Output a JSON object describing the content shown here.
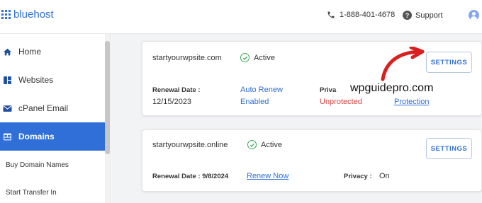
{
  "header": {
    "logo_text": "bluehost",
    "phone": "1-888-401-4678",
    "support_label": "Support"
  },
  "sidebar": {
    "items": [
      {
        "label": "Home",
        "icon": "home-icon"
      },
      {
        "label": "Websites",
        "icon": "websites-icon"
      },
      {
        "label": "cPanel Email",
        "icon": "mail-icon"
      },
      {
        "label": "Domains",
        "icon": "domains-icon",
        "active": true
      }
    ],
    "subitems": [
      "Buy Domain Names",
      "Start Transfer In"
    ]
  },
  "domains": [
    {
      "name": "startyourwpsite.com",
      "status": "Active",
      "renewal_label": "Renewal Date :",
      "renewal_date": "12/15/2023",
      "auto_renew_line1": "Auto Renew",
      "auto_renew_line2": "Enabled",
      "privacy_label": "Priva",
      "privacy_value": "Unprotected",
      "privacy_link": "Protection",
      "settings_label": "SETTINGS"
    },
    {
      "name": "startyourwpsite.online",
      "status": "Active",
      "renewal_label": "Renewal Date : 9/8/2024",
      "renew_link": "Renew Now",
      "privacy_label": "Privacy :",
      "privacy_value": "On",
      "settings_label": "SETTINGS"
    }
  ],
  "overlay": {
    "watermark": "wpguidepro.com"
  },
  "colors": {
    "brand": "#2f6fd7",
    "active_check": "#3aa757",
    "warning": "#d64541",
    "arrow": "#d92020"
  }
}
